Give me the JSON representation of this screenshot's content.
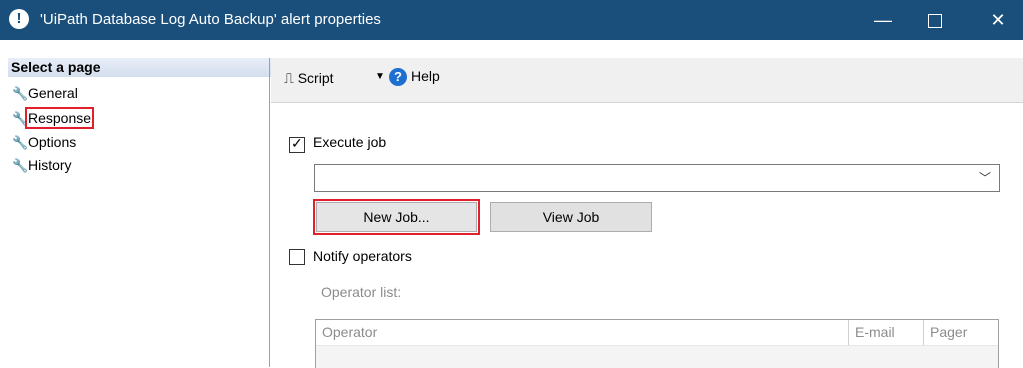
{
  "window": {
    "title": "'UiPath Database Log Auto Backup' alert properties",
    "icon": "info-icon",
    "controls": {
      "minimize": "—",
      "maximize": "",
      "close": "✕"
    }
  },
  "sidebar": {
    "header": "Select a page",
    "items": [
      {
        "label": "General",
        "icon": "wrench-icon"
      },
      {
        "label": "Response",
        "icon": "wrench-icon",
        "selected": true
      },
      {
        "label": "Options",
        "icon": "wrench-icon"
      },
      {
        "label": "History",
        "icon": "wrench-icon"
      }
    ]
  },
  "toolbar": {
    "script_label": "Script",
    "help_label": "Help"
  },
  "response": {
    "execute_job": {
      "label": "Execute job",
      "checked": true
    },
    "job_combo": {
      "value": ""
    },
    "new_job_button": "New Job...",
    "view_job_button": "View Job",
    "notify_operators": {
      "label": "Notify operators",
      "checked": false
    },
    "operator_list_label": "Operator list:",
    "operator_table": {
      "columns": [
        "Operator",
        "E-mail",
        "Pager"
      ],
      "rows": []
    }
  },
  "colors": {
    "titlebar": "#1a4f7c",
    "highlight": "#e0202a",
    "help_icon": "#1f6fd1"
  }
}
